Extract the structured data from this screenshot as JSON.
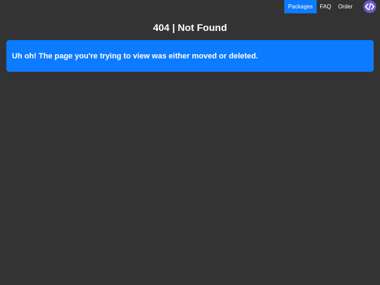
{
  "nav": {
    "items": [
      {
        "label": "Packages",
        "active": true
      },
      {
        "label": "FAQ",
        "active": false
      },
      {
        "label": "Order",
        "active": false
      }
    ],
    "logo_icon": "code-brackets-icon"
  },
  "page": {
    "title": "404 | Not Found"
  },
  "alert": {
    "message": "Uh oh! The page you're trying to view was either moved or deleted."
  },
  "colors": {
    "background": "#333333",
    "accent": "#0d7bff",
    "logo": "#6a5acd"
  }
}
